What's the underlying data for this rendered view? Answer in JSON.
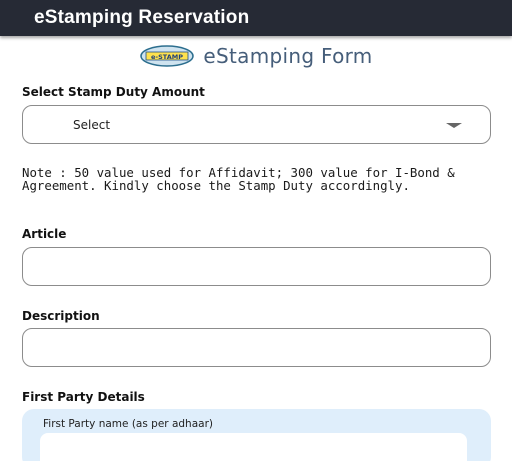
{
  "header": {
    "title": "eStamping Reservation"
  },
  "brand": {
    "logo_text": "e-STAMP",
    "title": "eStamping Form"
  },
  "stamp_duty": {
    "label": "Select Stamp Duty Amount",
    "selected": "Select"
  },
  "note": "Note : 50 value used for Affidavit; 300 value for I-Bond & Agreement. Kindly choose the Stamp Duty accordingly.",
  "article": {
    "label": "Article",
    "value": ""
  },
  "description": {
    "label": "Description",
    "value": ""
  },
  "first_party": {
    "section_label": "First Party Details",
    "name_label": "First Party name (as per adhaar)",
    "name_value": ""
  },
  "colors": {
    "appbar": "#262a35",
    "brand_text": "#465e7a",
    "card_bg": "#dfeefb"
  }
}
